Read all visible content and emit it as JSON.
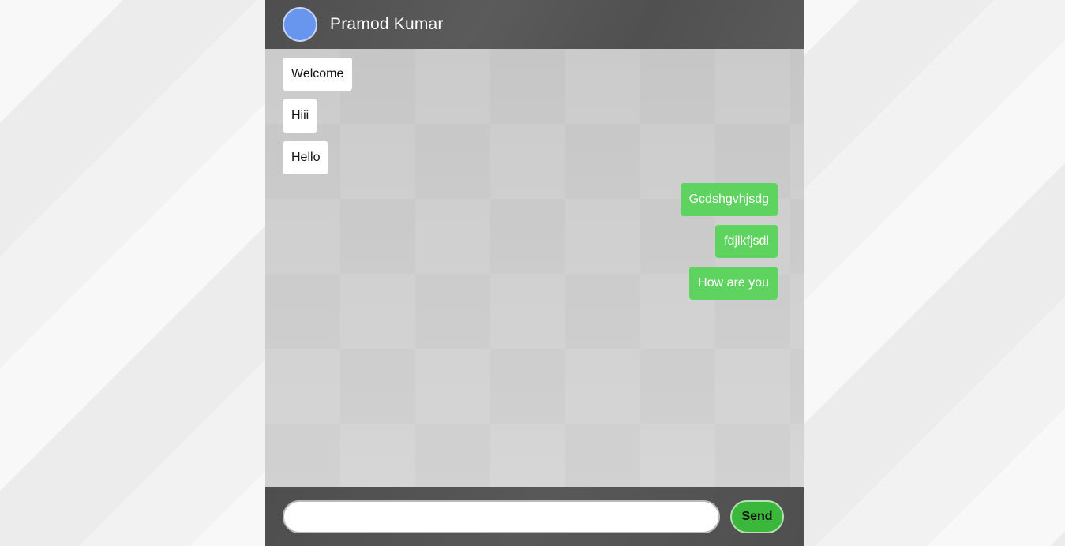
{
  "header": {
    "contact_name": "Pramod Kumar",
    "avatar_color": "#6896ee"
  },
  "messages": [
    {
      "direction": "incoming",
      "text": "Welcome"
    },
    {
      "direction": "incoming",
      "text": "Hiii"
    },
    {
      "direction": "incoming",
      "text": "Hello"
    },
    {
      "direction": "outgoing",
      "text": "Gcdshgvhjsdg"
    },
    {
      "direction": "outgoing",
      "text": "fdjlkfjsdl"
    },
    {
      "direction": "outgoing",
      "text": "How are you"
    }
  ],
  "composer": {
    "input_value": "",
    "input_placeholder": "",
    "send_label": "Send"
  },
  "colors": {
    "incoming_bubble": "#ffffff",
    "outgoing_bubble": "#5fd35f",
    "send_button": "#3bb83b",
    "header_bg": "#525252"
  }
}
